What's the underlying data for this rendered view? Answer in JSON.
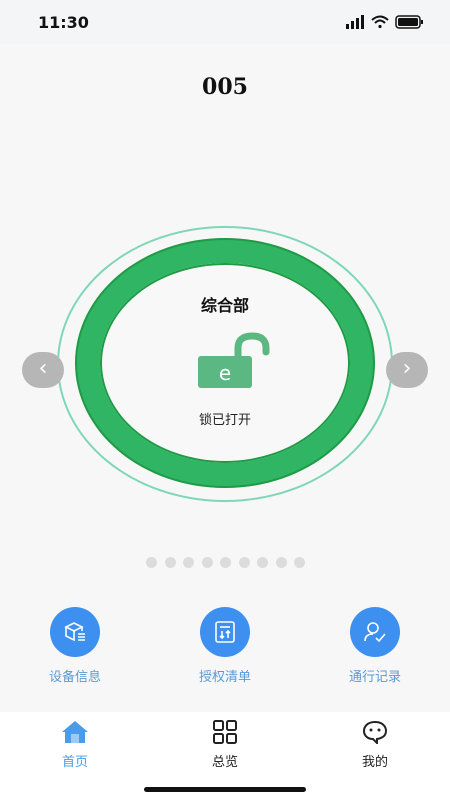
{
  "status_bar": {
    "time": "11:30"
  },
  "header": {
    "door_number": "005"
  },
  "lock_panel": {
    "department": "综合部",
    "lock_badge": "e",
    "status": "锁已打开",
    "ring_color": "#2fb564",
    "outer_ring_color": "#7fd6b8"
  },
  "pager": {
    "count": 9
  },
  "actions": [
    {
      "label": "设备信息",
      "icon": "device-box-icon"
    },
    {
      "label": "授权清单",
      "icon": "authorization-list-icon"
    },
    {
      "label": "通行记录",
      "icon": "access-record-icon"
    }
  ],
  "tabs": [
    {
      "label": "首页",
      "icon": "home-icon",
      "active": true
    },
    {
      "label": "总览",
      "icon": "grid-icon",
      "active": false
    },
    {
      "label": "我的",
      "icon": "chat-face-icon",
      "active": false
    }
  ],
  "colors": {
    "accent": "#3d8ff0",
    "tab_active": "#4a9be8"
  }
}
